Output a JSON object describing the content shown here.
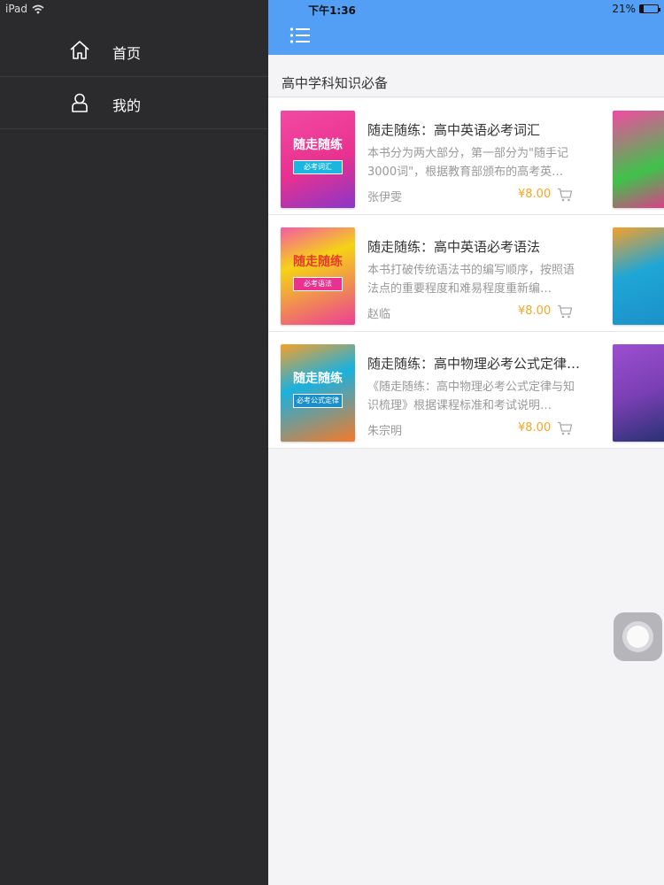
{
  "status_bar": {
    "device": "iPad",
    "time": "下午1:36",
    "battery_text": "21%",
    "battery_level": 0.21
  },
  "side_menu": {
    "items": [
      {
        "label": "首页",
        "icon": "home-icon"
      },
      {
        "label": "我的",
        "icon": "user-icon"
      }
    ]
  },
  "header": {
    "menu_icon": "list-menu-icon",
    "bar_color": "#539ff5"
  },
  "section": {
    "title": "高中学科知识必备"
  },
  "books": [
    {
      "title": "随走随练：高中英语必考词汇",
      "description": "本书分为两大部分，第一部分为\"随手记3000词\"，根据教育部颁布的高考英…",
      "author": "张伊雯",
      "price": "¥8.00",
      "cover_text": "随走随练",
      "cover_band": "必考词汇",
      "cover_color": "#e9318f",
      "peek_color": "#e7358e"
    },
    {
      "title": "随走随练：高中英语必考语法",
      "description": "本书打破传统语法书的编写顺序，按照语法点的重要程度和难易程度重新编…",
      "author": "赵临",
      "price": "¥8.00",
      "cover_text": "随走随练",
      "cover_band": "必考语法",
      "cover_color": "#ec3f95",
      "peek_color": "#1ea6d6"
    },
    {
      "title": "随走随练：高中物理必考公式定律…",
      "description": "《随走随练：高中物理必考公式定律与知识梳理》根据课程标准和考试说明…",
      "author": "朱宗明",
      "price": "¥8.00",
      "cover_text": "随走随练",
      "cover_band": "必考公式定律",
      "cover_color": "#1ab1df",
      "peek_color": "#7a3fb4"
    }
  ],
  "cart_icon": "cart-icon",
  "accent_price_color": "#f5a623"
}
